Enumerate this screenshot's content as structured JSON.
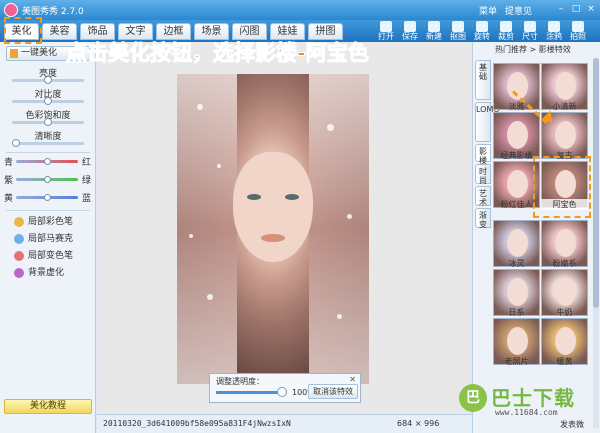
{
  "app": {
    "title": "美图秀秀 2.7.0",
    "menu": [
      "菜单",
      "提意见"
    ]
  },
  "tabs": [
    "美化",
    "美容",
    "饰品",
    "文字",
    "边框",
    "场景",
    "闪图",
    "娃娃",
    "拼图"
  ],
  "toolbar": [
    "打开",
    "保存",
    "新建",
    "抠图",
    "旋转",
    "裁剪",
    "尺寸",
    "涂鸦",
    "拍照"
  ],
  "left_panel": {
    "one_click": "一键美化",
    "adjustments": [
      {
        "label": "亮度",
        "value": 0.5
      },
      {
        "label": "对比度",
        "value": 0.5
      },
      {
        "label": "色彩饱和度",
        "value": 0.5
      },
      {
        "label": "清晰度",
        "value": 0.05
      }
    ],
    "color_balance": [
      {
        "left": "青",
        "right": "红",
        "value": 0.5,
        "color": "#e05050"
      },
      {
        "left": "紫",
        "right": "绿",
        "value": 0.5,
        "color": "#50c050"
      },
      {
        "left": "黄",
        "right": "蓝",
        "value": 0.5,
        "color": "#5080e0"
      }
    ],
    "local_tools": [
      "局部彩色笔",
      "局部马赛克",
      "局部变色笔",
      "背景虚化"
    ],
    "tutorial": "美化教程"
  },
  "canvas": {
    "opacity_panel": {
      "label": "调整透明度：",
      "value": "100%",
      "cancel": "取消该特效"
    }
  },
  "status": {
    "filename": "20110320_3d641009bf58e095a831F4jNwzsIxN",
    "dimensions": "684 × 996"
  },
  "right_panel": {
    "header": "热门推荐  >  影楼特效",
    "side_tabs": [
      "基础",
      "LOMO",
      "影楼",
      "时尚",
      "艺术",
      "渐变"
    ],
    "effects": [
      {
        "label": "淡雅",
        "tint": "#d7b3c3"
      },
      {
        "label": "小清新",
        "tint": "#e9c3cd"
      },
      {
        "label": "经典影楼",
        "tint": "#cf8aa0"
      },
      {
        "label": "复古",
        "tint": "#e3b5bd"
      },
      {
        "label": "粉红佳人",
        "tint": "#e6a1a8"
      },
      {
        "label": "阿宝色",
        "tint": "#b88478"
      },
      {
        "label": "冰灵",
        "tint": "#c7c2d8"
      },
      {
        "label": "粉嫩系",
        "tint": "#ecc0c4"
      },
      {
        "label": "日系",
        "tint": "#d6c6cf"
      },
      {
        "label": "牛奶",
        "tint": "#f0ddd9"
      },
      {
        "label": "老照片",
        "tint": "#c79a6e"
      },
      {
        "label": "暖黄",
        "tint": "#e0b470"
      }
    ]
  },
  "annotation": {
    "text": "点击美化按钮，选择影楼-阿宝色",
    "color": "#f4921e"
  },
  "watermark": {
    "text": "巴士下载",
    "url": "www.11684.com",
    "share": "发表微"
  }
}
